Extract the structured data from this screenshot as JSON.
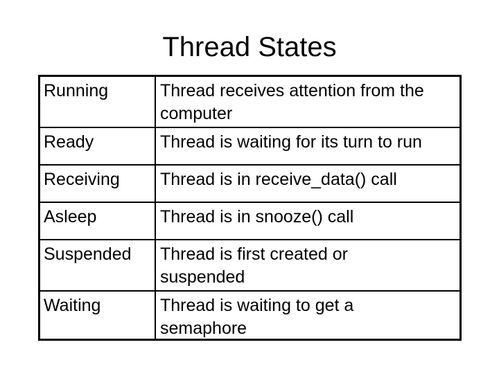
{
  "slide": {
    "title": "Thread States",
    "rows": [
      {
        "state": "Running",
        "description_lines": [
          "Thread receives attention from the",
          "computer"
        ]
      },
      {
        "state": "Ready",
        "description_lines": [
          "Thread is waiting for its turn to run"
        ]
      },
      {
        "state": "Receiving",
        "description_lines": [
          "Thread is in receive_data() call"
        ]
      },
      {
        "state": "Asleep",
        "description_lines": [
          "Thread is in snooze() call"
        ]
      },
      {
        "state": "Suspended",
        "description_lines": [
          "Thread is first created or",
          "suspended"
        ]
      },
      {
        "state": "Waiting",
        "description_lines": [
          "Thread is waiting to get a",
          "semaphore"
        ]
      }
    ]
  }
}
